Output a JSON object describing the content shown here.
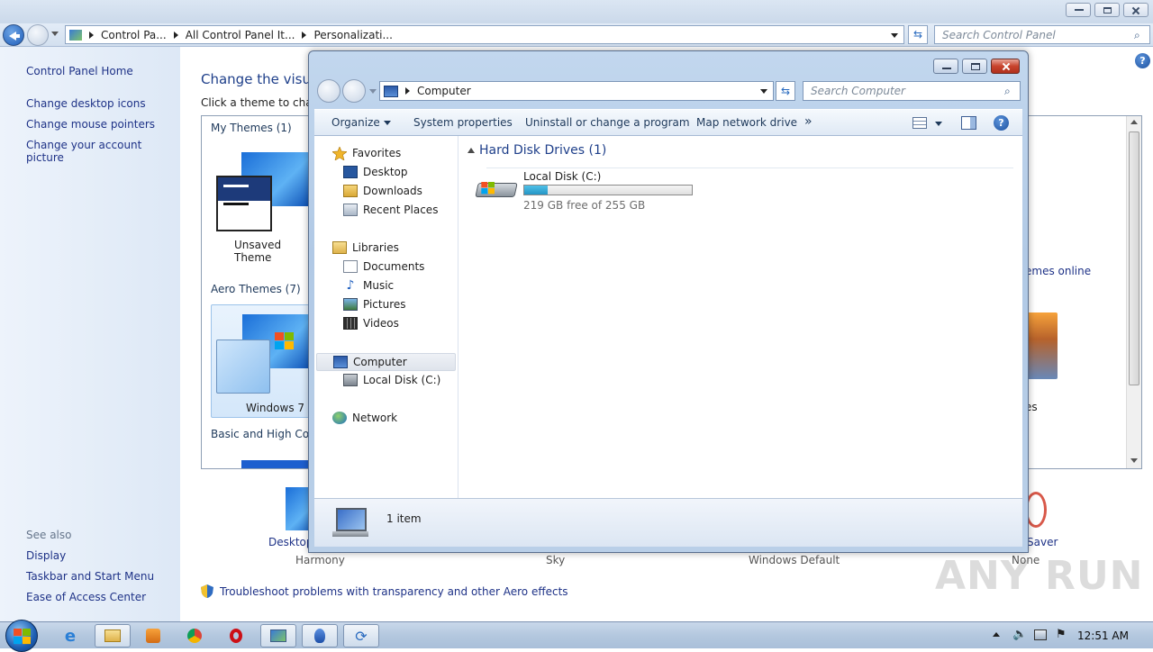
{
  "control_panel": {
    "address": [
      "Control Pa...",
      "All Control Panel It...",
      "Personalizati..."
    ],
    "search_placeholder": "Search Control Panel",
    "sidebar": {
      "home": "Control Panel Home",
      "links": [
        "Change desktop icons",
        "Change mouse pointers",
        "Change your account picture"
      ],
      "see_also": "See also",
      "see_also_links": [
        "Display",
        "Taskbar and Start Menu",
        "Ease of Access Center"
      ]
    },
    "main": {
      "title": "Change the visua",
      "subtitle": "Click a theme to chang",
      "my_themes": "My Themes (1)",
      "unsaved_theme": "Unsaved Theme",
      "aero_themes": "Aero Themes (7)",
      "windows7": "Windows 7",
      "basic_themes": "Basic and High Cont",
      "get_more_online": "emes online",
      "partial_theme_label": "es",
      "bottom_items": [
        "Desktop",
        "Saver"
      ],
      "bottom_sublabels": [
        "Harmony",
        "Sky",
        "Windows Default",
        "None"
      ],
      "troubleshoot": "Troubleshoot problems with transparency and other Aero effects"
    }
  },
  "explorer": {
    "address": "Computer",
    "search_placeholder": "Search Computer",
    "toolbar": {
      "organize": "Organize",
      "system_properties": "System properties",
      "uninstall": "Uninstall or change a program",
      "map_drive": "Map network drive",
      "more": "»"
    },
    "nav": {
      "favorites": "Favorites",
      "favorites_items": [
        "Desktop",
        "Downloads",
        "Recent Places"
      ],
      "libraries": "Libraries",
      "libraries_items": [
        "Documents",
        "Music",
        "Pictures",
        "Videos"
      ],
      "computer": "Computer",
      "computer_items": [
        "Local Disk (C:)"
      ],
      "network": "Network"
    },
    "content": {
      "group_header": "Hard Disk Drives (1)",
      "drive_name": "Local Disk (C:)",
      "drive_free": "219 GB free of 255 GB",
      "used_fraction": 0.14
    },
    "status": "1 item"
  },
  "taskbar": {
    "clock": "12:51 AM"
  },
  "watermark": "ANY RUN"
}
